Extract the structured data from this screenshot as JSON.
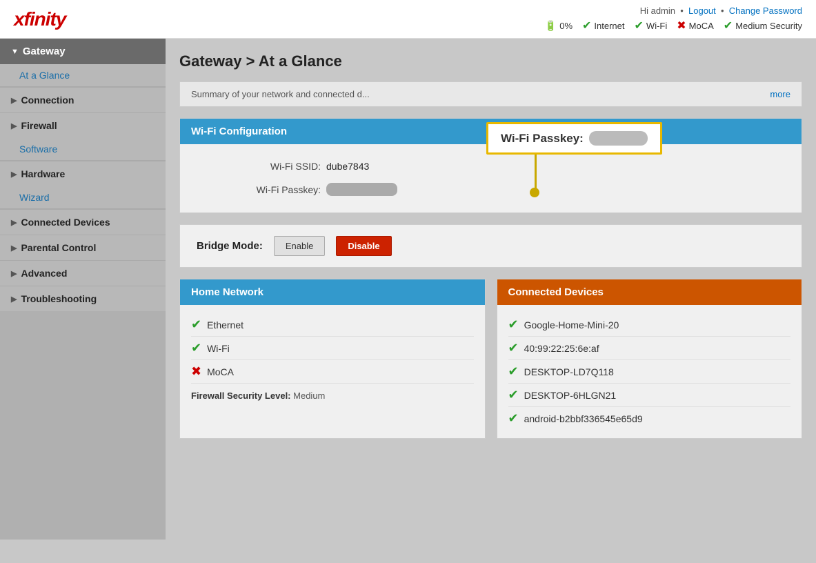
{
  "header": {
    "logo": "xfinity",
    "user": "Hi admin",
    "logout_label": "Logout",
    "change_password_label": "Change Password",
    "status_items": [
      {
        "icon": "battery",
        "label": "0%",
        "type": "neutral"
      },
      {
        "icon": "check",
        "label": "Internet",
        "type": "ok"
      },
      {
        "icon": "check",
        "label": "Wi-Fi",
        "type": "ok"
      },
      {
        "icon": "x",
        "label": "MoCA",
        "type": "error"
      },
      {
        "icon": "check",
        "label": "Medium Security",
        "type": "ok"
      }
    ]
  },
  "sidebar": {
    "gateway_label": "Gateway",
    "at_a_glance_label": "At a Glance",
    "connection_label": "Connection",
    "firewall_label": "Firewall",
    "software_label": "Software",
    "hardware_label": "Hardware",
    "wizard_label": "Wizard",
    "connected_devices_label": "Connected Devices",
    "parental_control_label": "Parental Control",
    "advanced_label": "Advanced",
    "troubleshooting_label": "Troubleshooting"
  },
  "main": {
    "page_title": "Gateway > At a Glance",
    "summary_text": "Summary of your network and connected d...",
    "more_label": "more",
    "wifi_config_header": "Wi-Fi Configuration",
    "wifi_ssid_label": "Wi-Fi SSID:",
    "wifi_ssid_value": "dube7843",
    "wifi_passkey_label": "Wi-Fi Passkey:",
    "wifi_passkey_placeholder": "••••••••",
    "popup_passkey_label": "Wi-Fi Passkey:",
    "bridge_mode_label": "Bridge Mode:",
    "enable_label": "Enable",
    "disable_label": "Disable",
    "home_network": {
      "header": "Home Network",
      "items": [
        {
          "label": "Ethernet",
          "status": "ok"
        },
        {
          "label": "Wi-Fi",
          "status": "ok"
        },
        {
          "label": "MoCA",
          "status": "error"
        }
      ],
      "firewall_label": "Firewall Security Level:",
      "firewall_value": "Medium"
    },
    "connected_devices": {
      "header": "Connected Devices",
      "items": [
        {
          "label": "Google-Home-Mini-20",
          "status": "ok"
        },
        {
          "label": "40:99:22:25:6e:af",
          "status": "ok"
        },
        {
          "label": "DESKTOP-LD7Q118",
          "status": "ok"
        },
        {
          "label": "DESKTOP-6HLGN21",
          "status": "ok"
        },
        {
          "label": "android-b2bbf336545e65d9",
          "status": "ok"
        }
      ]
    }
  }
}
